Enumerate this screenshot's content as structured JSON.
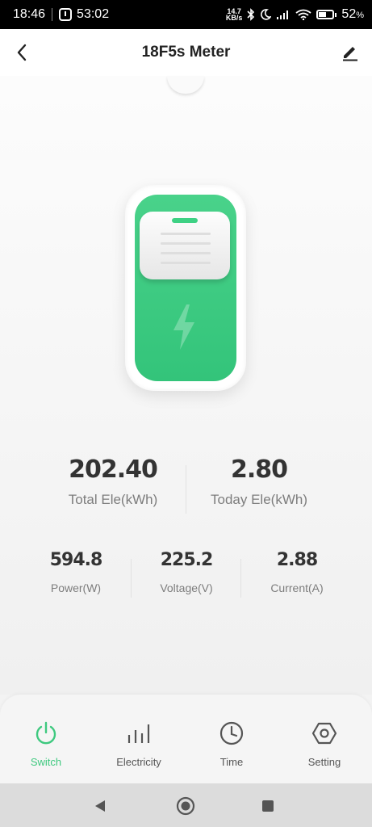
{
  "status_bar": {
    "time": "18:46",
    "timer": "53:02",
    "net_speed_value": "14.7",
    "net_speed_unit": "KB/s",
    "battery": "52",
    "battery_unit": "%",
    "battery_level": 0.52
  },
  "header": {
    "title": "18F5s Meter",
    "back_icon": "chevron-left-icon",
    "edit_icon": "pencil-icon"
  },
  "device": {
    "icon": "lightning-bolt-icon",
    "accent_color": "#3ec97f"
  },
  "stats_primary": [
    {
      "value": "202.40",
      "label": "Total Ele(kWh)"
    },
    {
      "value": "2.80",
      "label": "Today Ele(kWh)"
    }
  ],
  "stats_secondary": [
    {
      "value": "594.8",
      "label": "Power(W)"
    },
    {
      "value": "225.2",
      "label": "Voltage(V)"
    },
    {
      "value": "2.88",
      "label": "Current(A)"
    }
  ],
  "bottom_nav": [
    {
      "label": "Switch",
      "icon": "power-icon",
      "active": true
    },
    {
      "label": "Electricity",
      "icon": "bar-chart-icon",
      "active": false
    },
    {
      "label": "Time",
      "icon": "clock-icon",
      "active": false
    },
    {
      "label": "Setting",
      "icon": "hexagon-gear-icon",
      "active": false
    }
  ],
  "system_nav": [
    "back-triangle-icon",
    "home-circle-icon",
    "recents-square-icon"
  ]
}
